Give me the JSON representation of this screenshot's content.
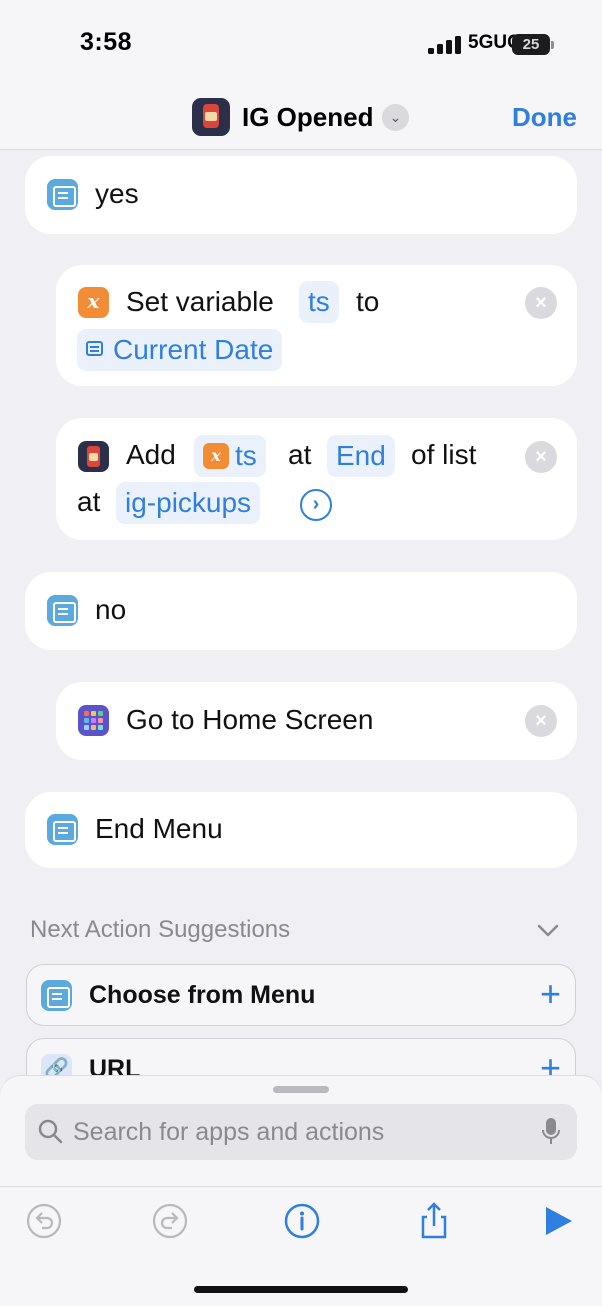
{
  "status": {
    "time": "3:58",
    "network": "5GUC",
    "battery": "25"
  },
  "nav": {
    "title": "IG Opened",
    "done_label": "Done"
  },
  "blocks": {
    "yes": "yes",
    "set_variable": {
      "label": "Set variable",
      "var_name": "ts",
      "to": "to",
      "value": "Current Date"
    },
    "add": {
      "label": "Add",
      "var_name": "ts",
      "at": "at",
      "position": "End",
      "of_list": "of list",
      "at2": "at",
      "list_name": "ig-pickups"
    },
    "no": "no",
    "go_home": "Go to Home Screen",
    "end_menu": "End Menu"
  },
  "suggestions": {
    "title": "Next Action Suggestions",
    "items": [
      {
        "label": "Choose from Menu",
        "icon": "menu-icon"
      },
      {
        "label": "URL",
        "icon": "link-icon"
      }
    ]
  },
  "search": {
    "placeholder": "Search for apps and actions"
  },
  "toolbar": {
    "icons": [
      "undo-icon",
      "redo-icon",
      "info-icon",
      "share-icon",
      "play-icon"
    ]
  },
  "colors": {
    "accent": "#2f7fde",
    "background": "#f0f0f4",
    "variable": "#f28d36",
    "menu": "#5ba9dd"
  }
}
